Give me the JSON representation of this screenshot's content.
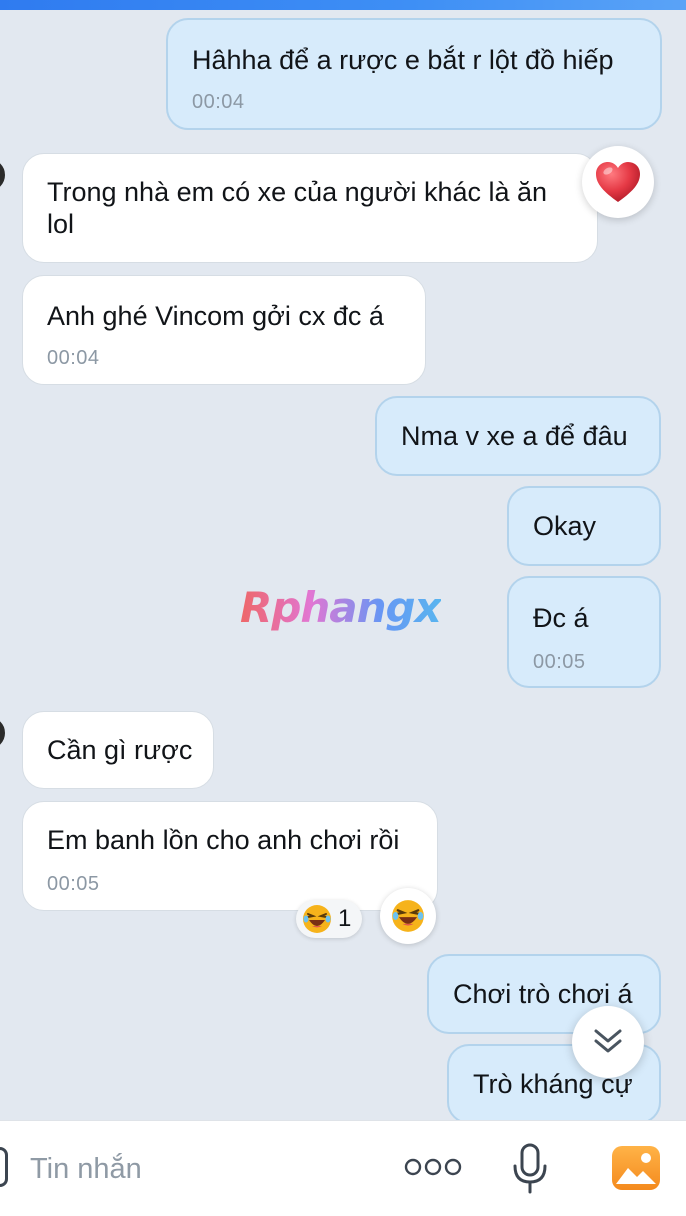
{
  "watermark": "Rphangx",
  "messages": [
    {
      "side": "out",
      "text": "Hâhha để a rược e bắt r lột đồ hiếp",
      "time": "00:04"
    },
    {
      "side": "in",
      "text": "Trong nhà em có xe của người khác là ăn lol",
      "reaction": "heart"
    },
    {
      "side": "in",
      "text": "Anh ghé Vincom gởi cx đc á",
      "time": "00:04"
    },
    {
      "side": "out",
      "text": "Nma v xe a để đâu"
    },
    {
      "side": "out",
      "text": "Okay"
    },
    {
      "side": "out",
      "text": "Đc á",
      "time": "00:05"
    },
    {
      "side": "in",
      "text": "Cần gì rược"
    },
    {
      "side": "in",
      "text": "Em banh lồn cho anh chơi rồi",
      "time": "00:05",
      "reaction": "laughing",
      "reaction_count": "1"
    },
    {
      "side": "out",
      "text": "Chơi trò chơi á"
    },
    {
      "side": "out",
      "text": "Trò kháng cự"
    }
  ],
  "composer": {
    "placeholder": "Tin nhắn"
  },
  "colors": {
    "background": "#e2e8f0",
    "outgoing_bubble": "#d7ebfb",
    "incoming_bubble": "#ffffff",
    "timestamp": "#8c98a4",
    "heart": "#e53945",
    "emoji_face": "#f6b31b",
    "image_icon": "#f7a02a"
  },
  "icons": [
    "heart-icon",
    "laughing-face-icon",
    "chevron-double-down-icon",
    "more-dots-icon",
    "microphone-icon",
    "image-icon",
    "sticker-icon"
  ]
}
